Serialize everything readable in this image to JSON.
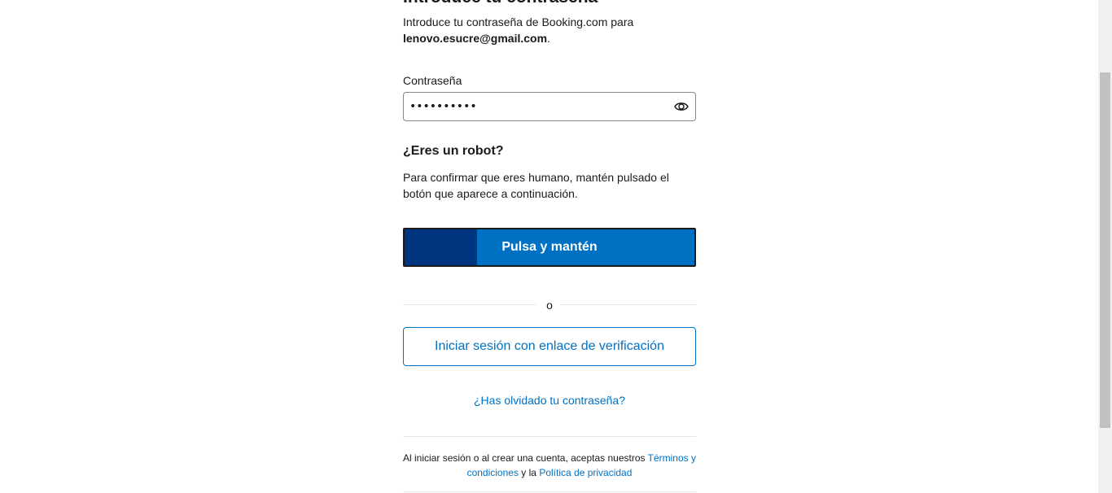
{
  "heading": "Introduce tu contraseña",
  "intro": {
    "text": "Introduce tu contraseña de Booking.com para",
    "email": "lenovo.esucre@gmail.com",
    "suffix": "."
  },
  "password": {
    "label": "Contraseña",
    "value": "••••••••••",
    "toggle_icon": "eye-icon"
  },
  "robot": {
    "title": "¿Eres un robot?",
    "description": "Para confirmar que eres humano, mantén pulsado el botón que aparece a continuación.",
    "button_label": "Pulsa y mantén",
    "hold_progress": 0.25,
    "colors": {
      "fill": "#003580",
      "base": "#0071c2"
    }
  },
  "divider": {
    "label": "o"
  },
  "verify_button": {
    "label": "Iniciar sesión con enlace de verificación"
  },
  "forgot_link": "¿Has olvidado tu contraseña?",
  "terms": {
    "prefix": "Al iniciar sesión o al crear una cuenta, aceptas nuestros",
    "terms_link": "Términos y condiciones",
    "middle": "y la",
    "privacy_link": "Política de privacidad"
  },
  "colors": {
    "accent": "#0071c2",
    "brand_dark": "#003580",
    "text": "#1a1a1a"
  }
}
